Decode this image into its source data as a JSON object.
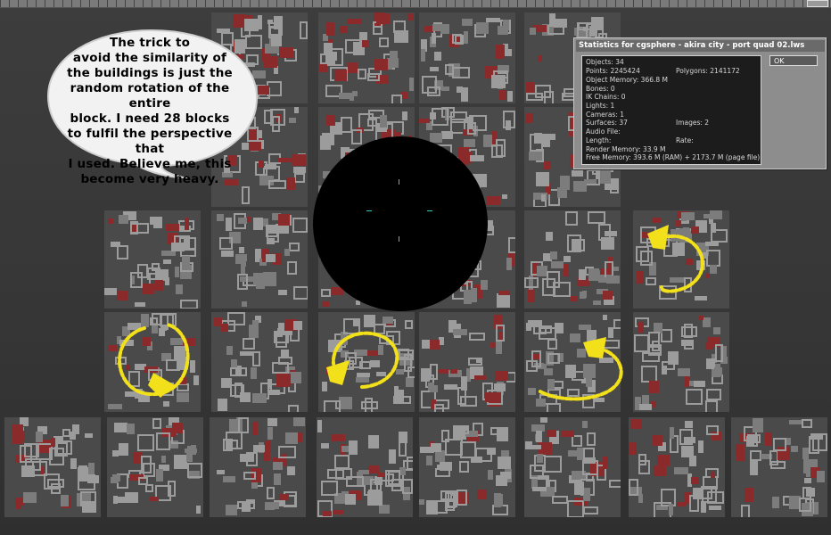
{
  "speech_bubble": {
    "lines": [
      "The trick to",
      "avoid the similarity of",
      "the buildings is just the",
      "random rotation of the entire",
      "block. I need 28 blocks",
      "to fulfil the perspective that",
      "I used. Believe me, this",
      "become very heavy."
    ]
  },
  "stats_dialog": {
    "title": "Statistics for cgsphere - akira city - port quad 02.lws",
    "ok_label": "OK",
    "rows": {
      "objects": "Objects: 34",
      "points": "Points: 2245424",
      "polygons": "Polygons: 2141172",
      "object_memory": "Object Memory: 366.8 M",
      "bones": "Bones: 0",
      "ik_chains": "IK Chains: 0",
      "lights": "Lights: 1",
      "cameras": "Cameras: 1",
      "surfaces": "Surfaces: 37",
      "images": "Images: 2",
      "audio_file": "Audio File:",
      "length": "Length:",
      "rate": "Rate:",
      "render_memory": "Render Memory: 33.9 M",
      "free_memory": "Free Memory: 393.6 M (RAM) + 2173.7 M (page file)"
    }
  },
  "colors": {
    "background": "#3a3a3a",
    "block": "#4a4a4a",
    "building_light": "#9c9c9c",
    "building_red": "#8a2a2a",
    "arrow": "#f2e01a",
    "sphere": "#000000",
    "crosshair": "#2fd0c0"
  },
  "icons": {
    "rotation_arrows": "circular-rotation-arrow-icon",
    "crosshair": "crosshair-icon"
  }
}
